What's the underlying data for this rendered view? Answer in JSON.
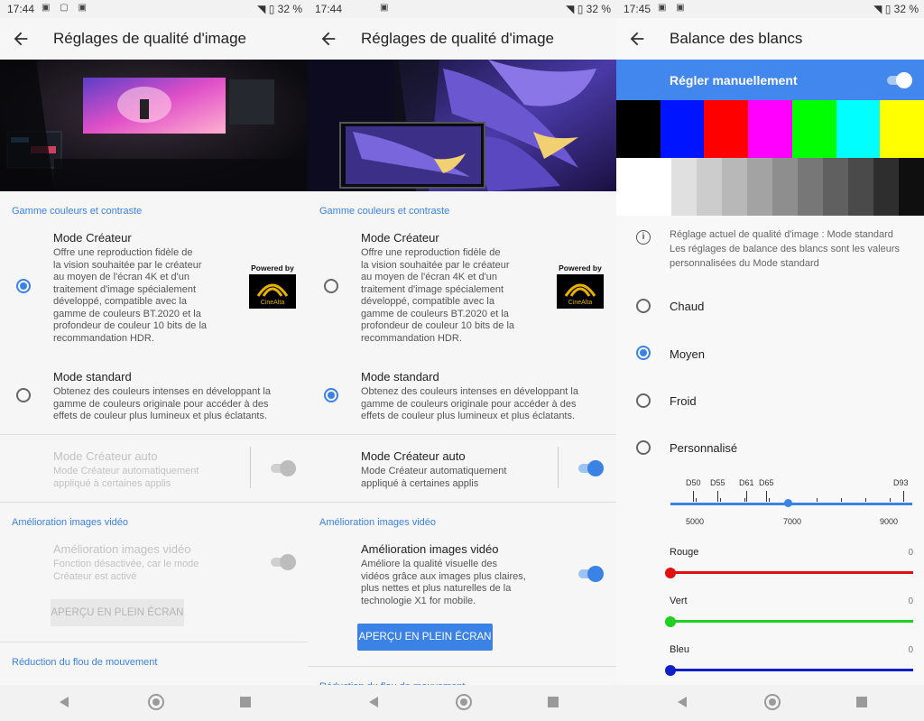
{
  "screen1": {
    "status": {
      "time": "17:44",
      "battery": "32 %"
    },
    "title": "Réglages de qualité d'image",
    "section_color_title": "Gamme couleurs et contraste",
    "creator_title": "Mode Créateur",
    "creator_desc": [
      "Offre une reproduction fidèle de",
      "la vision souhaitée par le créateur",
      "au moyen de l'écran 4K et d'un",
      "traitement d'image spécialement",
      "développé, compatible avec la",
      "gamme de couleurs BT.2020 et la",
      "profondeur de couleur 10 bits de la",
      "recommandation HDR."
    ],
    "creator_selected": true,
    "badge_powered": "Powered by",
    "badge_brand": "CineAlta",
    "standard_title": "Mode standard",
    "standard_desc": [
      "Obtenez des couleurs intenses en développant la",
      "gamme de couleurs originale pour accéder à des",
      "effets de couleur plus lumineux et plus éclatants."
    ],
    "auto_title": "Mode Créateur auto",
    "auto_desc": [
      "Mode Créateur automatiquement",
      "appliqué à certaines applis"
    ],
    "section_video_title": "Amélioration images vidéo",
    "video_title": "Amélioration images vidéo",
    "video_desc": [
      "Fonction désactivée, car le mode",
      "Créateur est activé"
    ],
    "preview_button": "APERÇU EN PLEIN ÉCRAN",
    "section_motion_title": "Réduction du flou de mouvement"
  },
  "screen2": {
    "status": {
      "time": "17:44",
      "battery": "32 %"
    },
    "title": "Réglages de qualité d'image",
    "section_color_title": "Gamme couleurs et contraste",
    "creator_title": "Mode Créateur",
    "creator_desc": [
      "Offre une reproduction fidèle de",
      "la vision souhaitée par le créateur",
      "au moyen de l'écran 4K et d'un",
      "traitement d'image spécialement",
      "développé, compatible avec la",
      "gamme de couleurs BT.2020 et la",
      "profondeur de couleur 10 bits de la",
      "recommandation HDR."
    ],
    "badge_powered": "Powered by",
    "badge_brand": "CineAlta",
    "standard_title": "Mode standard",
    "standard_desc": [
      "Obtenez des couleurs intenses en développant la",
      "gamme de couleurs originale pour accéder à des",
      "effets de couleur plus lumineux et plus éclatants."
    ],
    "standard_selected": true,
    "auto_title": "Mode Créateur auto",
    "auto_desc": [
      "Mode Créateur automatiquement",
      "appliqué à certaines applis"
    ],
    "section_video_title": "Amélioration images vidéo",
    "video_title": "Amélioration images vidéo",
    "video_desc": [
      "Améliore la qualité visuelle des",
      "vidéos grâce aux images plus claires,",
      "plus nettes et plus naturelles de la",
      "technologie X1 for mobile."
    ],
    "preview_button": "APERÇU EN PLEIN ÉCRAN",
    "section_motion_title": "Réduction du flou de mouvement"
  },
  "screen3": {
    "status": {
      "time": "17:45",
      "battery": "32 %"
    },
    "title": "Balance des blancs",
    "manual_label": "Régler manuellement",
    "manual_on": true,
    "color_bars_top": [
      "#000000",
      "#0014ff",
      "#ff0000",
      "#ff00ff",
      "#00ff00",
      "#00ffff",
      "#ffff00"
    ],
    "gray_bars": [
      "#ffffff",
      "#e0e0e0",
      "#cccccc",
      "#b8b8b8",
      "#a3a3a3",
      "#8e8e8e",
      "#777777",
      "#606060",
      "#4a4a4a",
      "#2e2e2e",
      "#0f0f0f"
    ],
    "info_line1": "Réglage actuel de qualité d'image : Mode standard",
    "info_line2": "Les réglages de balance des blancs sont les valeurs",
    "info_line3": "personnalisées du Mode standard",
    "options": [
      "Chaud",
      "Moyen",
      "Froid",
      "Personnalisé"
    ],
    "selected_option": "Moyen",
    "d_labels": [
      "D50",
      "D55",
      "D61",
      "D65",
      "D93"
    ],
    "k_labels": [
      "5000",
      "7000",
      "9000"
    ],
    "kelvin_value": 6900,
    "sliders": [
      {
        "name": "Rouge",
        "value": "0",
        "color": "#e01010"
      },
      {
        "name": "Vert",
        "value": "0",
        "color": "#20d020"
      },
      {
        "name": "Bleu",
        "value": "0",
        "color": "#1020c8"
      }
    ]
  },
  "colors": {
    "accent": "#3b82e6",
    "manual_bar": "#4187ee"
  }
}
